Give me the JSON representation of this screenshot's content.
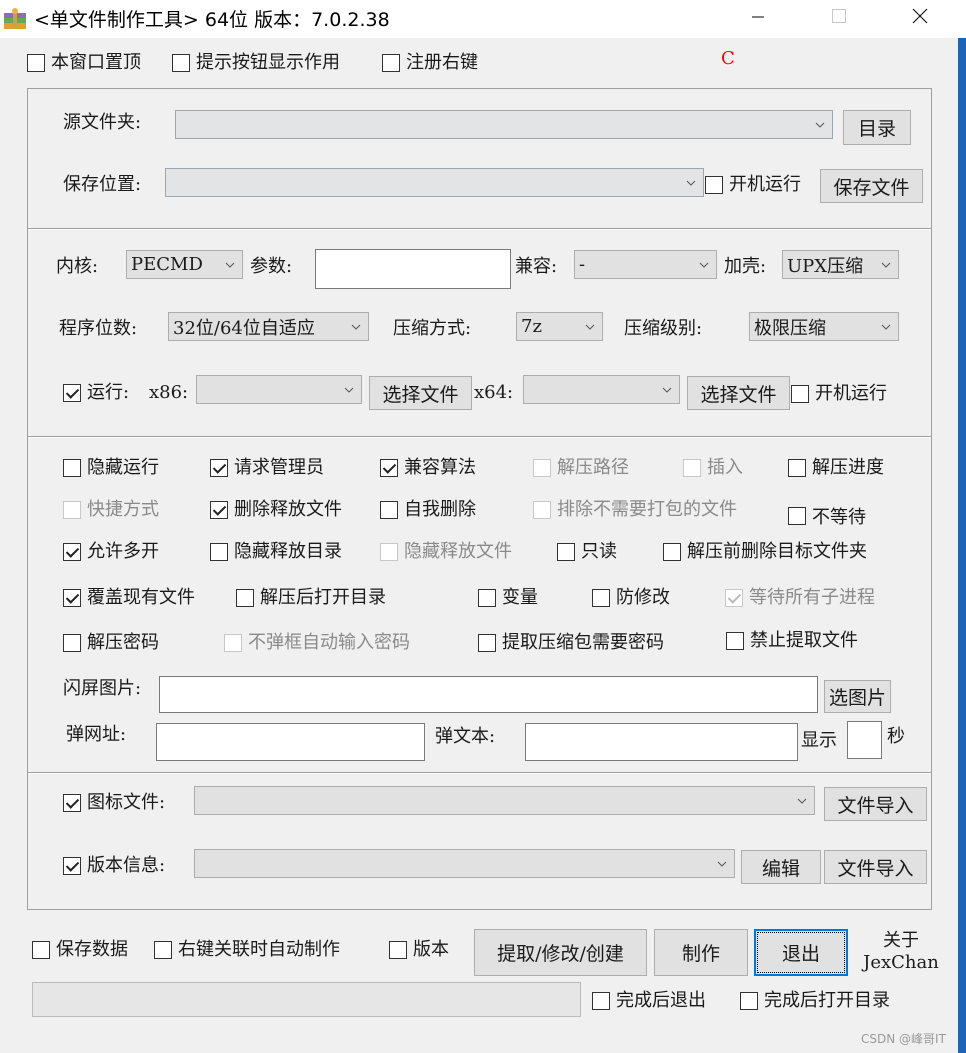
{
  "window": {
    "title": "<单文件制作工具> 64位 版本：7.0.2.38",
    "controls": [
      "minimize",
      "maximize",
      "close"
    ]
  },
  "top_options": [
    {
      "label": "本窗口置顶",
      "checked": false
    },
    {
      "label": "提示按钮显示作用",
      "checked": false
    },
    {
      "label": "注册右键",
      "checked": false
    }
  ],
  "marker_text": "C",
  "marker_color": "#ff0000",
  "paths": {
    "source_label": "源文件夹:",
    "source_value": "",
    "dir_button": "目录",
    "save_label": "保存位置:",
    "save_value": "",
    "autostart_label": "开机运行",
    "autostart_checked": false,
    "save_file_button": "保存文件"
  },
  "config": {
    "kernel_label": "内核:",
    "kernel_value": "PECMD",
    "params_label": "参数:",
    "params_value": "",
    "compat_label": "兼容:",
    "compat_value": "-",
    "shell_label": "加壳:",
    "shell_value": "UPX压缩",
    "bits_label": "程序位数:",
    "bits_value": "32位/64位自适应",
    "compress_method_label": "压缩方式:",
    "compress_method_value": "7z",
    "compress_level_label": "压缩级别:",
    "compress_level_value": "极限压缩",
    "run_label": "运行:",
    "run_checked": true,
    "x86_label": "x86:",
    "x86_value": "",
    "x86_button": "选择文件",
    "x64_label": "x64:",
    "x64_value": "",
    "x64_button": "选择文件",
    "run_autostart_label": "开机运行",
    "run_autostart_checked": false
  },
  "options": [
    {
      "label": "隐藏运行",
      "checked": false,
      "disabled": false
    },
    {
      "label": "请求管理员",
      "checked": true,
      "disabled": false
    },
    {
      "label": "兼容算法",
      "checked": true,
      "disabled": false
    },
    {
      "label": "解压路径",
      "checked": false,
      "disabled": true
    },
    {
      "label": "插入",
      "checked": false,
      "disabled": true
    },
    {
      "label": "解压进度",
      "checked": false,
      "disabled": false
    },
    {
      "label": "快捷方式",
      "checked": false,
      "disabled": true
    },
    {
      "label": "删除释放文件",
      "checked": true,
      "disabled": false
    },
    {
      "label": "自我删除",
      "checked": false,
      "disabled": false
    },
    {
      "label": "排除不需要打包的文件",
      "checked": false,
      "disabled": true
    },
    {
      "label": "不等待",
      "checked": false,
      "disabled": false
    },
    {
      "label": "允许多开",
      "checked": true,
      "disabled": false
    },
    {
      "label": "隐藏释放目录",
      "checked": false,
      "disabled": false
    },
    {
      "label": "隐藏释放文件",
      "checked": false,
      "disabled": true
    },
    {
      "label": "只读",
      "checked": false,
      "disabled": false
    },
    {
      "label": "解压前删除目标文件夹",
      "checked": false,
      "disabled": false
    },
    {
      "label": "覆盖现有文件",
      "checked": true,
      "disabled": false
    },
    {
      "label": "解压后打开目录",
      "checked": false,
      "disabled": false
    },
    {
      "label": "变量",
      "checked": false,
      "disabled": false
    },
    {
      "label": "防修改",
      "checked": false,
      "disabled": false
    },
    {
      "label": "等待所有子进程",
      "checked": true,
      "disabled": true
    },
    {
      "label": "解压密码",
      "checked": false,
      "disabled": false
    },
    {
      "label": "不弹框自动输入密码",
      "checked": false,
      "disabled": true
    },
    {
      "label": "提取压缩包需要密码",
      "checked": false,
      "disabled": false
    },
    {
      "label": "禁止提取文件",
      "checked": false,
      "disabled": false
    }
  ],
  "splash": {
    "label": "闪屏图片:",
    "value": "",
    "button": "选图片"
  },
  "popup": {
    "url_label": "弹网址:",
    "url_value": "",
    "text_label": "弹文本:",
    "text_value": "",
    "show_label": "显示",
    "seconds_value": "",
    "seconds_label": "秒"
  },
  "resources": {
    "icon_label": "图标文件:",
    "icon_checked": true,
    "icon_value": "",
    "icon_import_button": "文件导入",
    "version_label": "版本信息:",
    "version_checked": true,
    "version_value": "",
    "edit_button": "编辑",
    "version_import_button": "文件导入"
  },
  "footer": {
    "save_data_label": "保存数据",
    "save_data_checked": false,
    "auto_make_label": "右键关联时自动制作",
    "auto_make_checked": false,
    "version_label": "版本",
    "version_checked": false,
    "extract_button": "提取/修改/创建",
    "make_button": "制作",
    "exit_button": "退出",
    "about_line1": "关于",
    "about_line2": "JexChan",
    "progress_percent": 0,
    "exit_after_label": "完成后退出",
    "exit_after_checked": false,
    "open_dir_after_label": "完成后打开目录",
    "open_dir_after_checked": false
  },
  "watermark": "CSDN @峰哥IT"
}
